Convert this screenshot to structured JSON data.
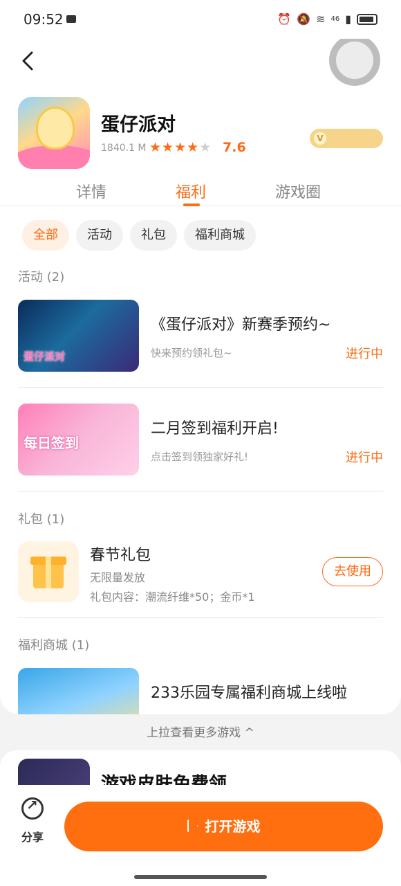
{
  "status": {
    "time": "09:52",
    "network": "46"
  },
  "app": {
    "name": "蛋仔派对",
    "size": "1840.1 M",
    "rating": "7.6",
    "stars_filled": 4,
    "stars_total": 5
  },
  "tabs": [
    {
      "label": "详情",
      "active": false
    },
    {
      "label": "福利",
      "active": true
    },
    {
      "label": "游戏圈",
      "active": false
    }
  ],
  "filters": [
    {
      "label": "全部",
      "active": true
    },
    {
      "label": "活动",
      "active": false
    },
    {
      "label": "礼包",
      "active": false
    },
    {
      "label": "福利商城",
      "active": false
    }
  ],
  "activities": {
    "title": "活动 (2)",
    "items": [
      {
        "title": "《蛋仔派对》新赛季预约~",
        "subtitle": "快来预约领礼包~",
        "status": "进行中",
        "thumb_text": "蛋仔派对"
      },
      {
        "title": "二月签到福利开启!",
        "subtitle": "点击签到领独家好礼!",
        "status": "进行中",
        "thumb_text": "每日签到"
      }
    ]
  },
  "gifts": {
    "title": "礼包 (1)",
    "item": {
      "title": "春节礼包",
      "line1": "无限量发放",
      "line2": "礼包内容：潮流纤维*50；金币*1",
      "button": "去使用"
    }
  },
  "shop": {
    "title": "福利商城 (1)",
    "item": {
      "title": "233乐园专属福利商城上线啦"
    }
  },
  "pull_hint": "上拉查看更多游戏 ^",
  "next_game": {
    "title": "游戏皮肤免费领"
  },
  "bottom": {
    "share": "分享",
    "open": "打开游戏"
  },
  "colors": {
    "accent": "#ff6a13"
  }
}
